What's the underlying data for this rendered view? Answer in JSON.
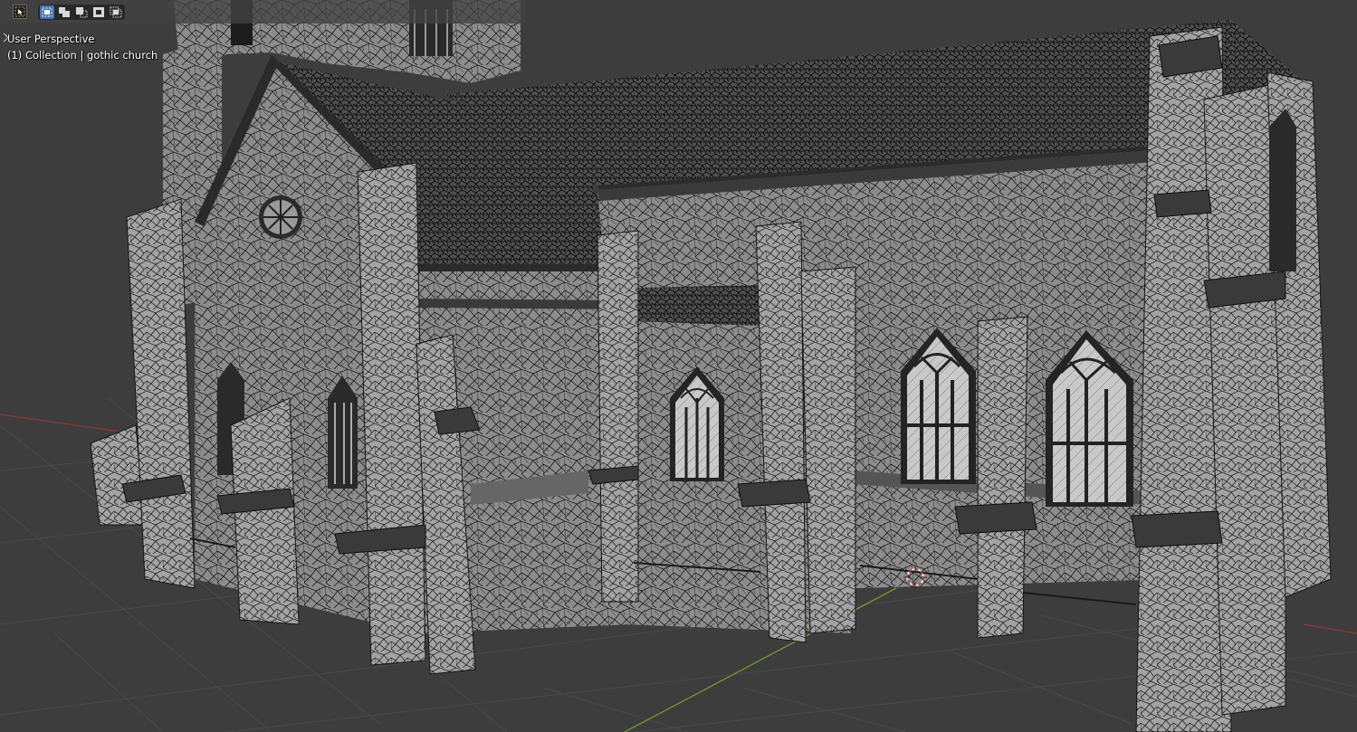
{
  "viewport": {
    "view_name": "User Perspective",
    "collection_label": "(1) Collection | gothic church",
    "background_color": "#3d3d3d",
    "grid_color": "#4a4a4a",
    "x_axis_color": "#8a3838",
    "y_axis_color": "#6f9a2f",
    "wire_color": "#111111",
    "surface_color": "#8f8f8f"
  },
  "header": {
    "mode_icon": "select-cursor-icon",
    "selection_modes": [
      {
        "name": "set-new-selection",
        "icon": "select-new-icon",
        "active": true
      },
      {
        "name": "extend-selection",
        "icon": "select-extend-icon",
        "active": false
      },
      {
        "name": "subtract-selection",
        "icon": "select-subtract-icon",
        "active": false
      },
      {
        "name": "invert-selection",
        "icon": "select-invert-icon",
        "active": false
      },
      {
        "name": "intersect-selection",
        "icon": "select-intersect-icon",
        "active": false
      }
    ],
    "accent_color": "#4772b3"
  },
  "scene": {
    "object_name": "gothic church",
    "display": "wireframe overlay",
    "cursor_icon": "3d-cursor-icon"
  }
}
